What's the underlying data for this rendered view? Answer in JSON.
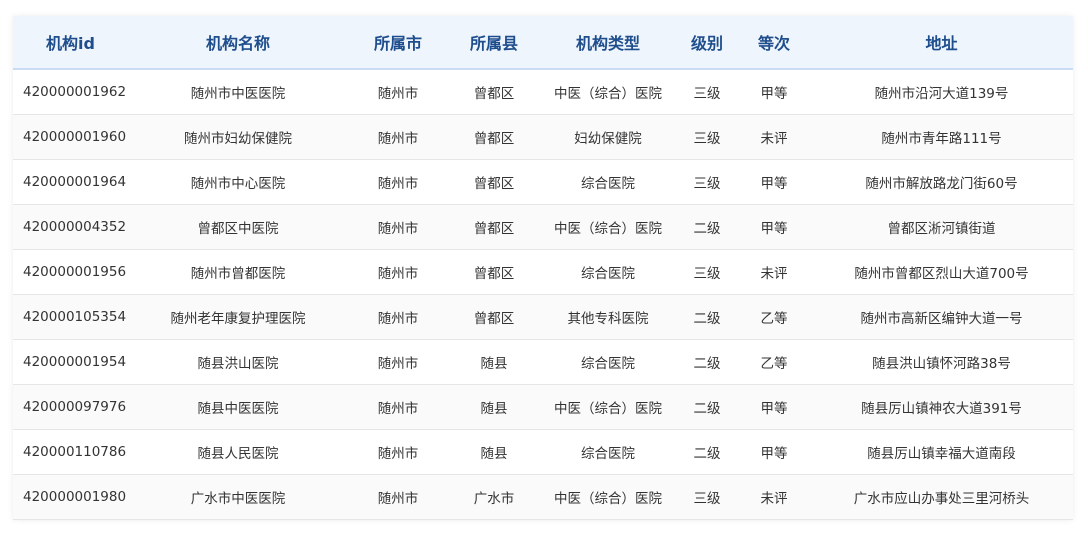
{
  "table": {
    "headers": [
      "机构id",
      "机构名称",
      "所属市",
      "所属县",
      "机构类型",
      "级别",
      "等次",
      "地址"
    ],
    "rows": [
      [
        "420000001962",
        "随州市中医医院",
        "随州市",
        "曾都区",
        "中医（综合）医院",
        "三级",
        "甲等",
        "随州市沿河大道139号"
      ],
      [
        "420000001960",
        "随州市妇幼保健院",
        "随州市",
        "曾都区",
        "妇幼保健院",
        "三级",
        "未评",
        "随州市青年路111号"
      ],
      [
        "420000001964",
        "随州市中心医院",
        "随州市",
        "曾都区",
        "综合医院",
        "三级",
        "甲等",
        "随州市解放路龙门街60号"
      ],
      [
        "420000004352",
        "曾都区中医院",
        "随州市",
        "曾都区",
        "中医（综合）医院",
        "二级",
        "甲等",
        "曾都区淅河镇街道"
      ],
      [
        "420000001956",
        "随州市曾都医院",
        "随州市",
        "曾都区",
        "综合医院",
        "三级",
        "未评",
        "随州市曾都区烈山大道700号"
      ],
      [
        "420000105354",
        "随州老年康复护理医院",
        "随州市",
        "曾都区",
        "其他专科医院",
        "二级",
        "乙等",
        "随州市高新区编钟大道一号"
      ],
      [
        "420000001954",
        "随县洪山医院",
        "随州市",
        "随县",
        "综合医院",
        "二级",
        "乙等",
        "随县洪山镇怀河路38号"
      ],
      [
        "420000097976",
        "随县中医医院",
        "随州市",
        "随县",
        "中医（综合）医院",
        "二级",
        "甲等",
        "随县厉山镇神农大道391号"
      ],
      [
        "420000110786",
        "随县人民医院",
        "随州市",
        "随县",
        "综合医院",
        "二级",
        "甲等",
        "随县厉山镇幸福大道南段"
      ],
      [
        "420000001980",
        "广水市中医医院",
        "随州市",
        "广水市",
        "中医（综合）医院",
        "三级",
        "未评",
        "广水市应山办事处三里河桥头"
      ]
    ]
  },
  "colors": {
    "header_bg": "#eef5fd",
    "header_text": "#1f4e8c",
    "row_alt_bg": "#fafafa",
    "border": "#e6e6e6"
  }
}
